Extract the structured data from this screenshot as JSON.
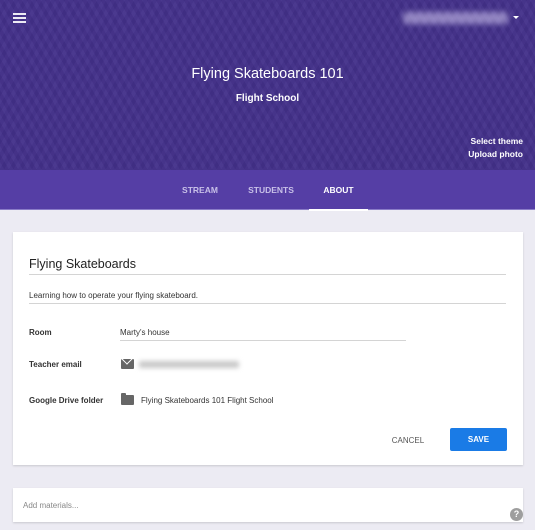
{
  "header": {
    "menu_icon": "hamburger-menu-icon",
    "account_email": "(redacted email)",
    "account_caret_icon": "caret-down-icon",
    "class_title": "Flying Skateboards 101",
    "class_section": "Flight School",
    "select_theme": "Select theme",
    "upload_photo": "Upload photo",
    "theme_color": "#43308a"
  },
  "tabs": [
    {
      "label": "STREAM",
      "active": false
    },
    {
      "label": "STUDENTS",
      "active": false
    },
    {
      "label": "ABOUT",
      "active": true
    }
  ],
  "about": {
    "title_value": "Flying Skateboards",
    "description_value": "Learning how to operate your flying skateboard.",
    "room_label": "Room",
    "room_value": "Marty's house",
    "teacher_email_label": "Teacher email",
    "teacher_email_icon": "email-icon",
    "teacher_email_value": "(redacted email)",
    "drive_folder_label": "Google Drive folder",
    "drive_folder_icon": "folder-icon",
    "drive_folder_value": "Flying Skateboards 101 Flight School",
    "cancel_label": "CANCEL",
    "save_label": "SAVE",
    "save_color": "#1a7be6"
  },
  "materials": {
    "placeholder": "Add materials..."
  },
  "help": {
    "icon": "help-icon",
    "label": "?"
  }
}
